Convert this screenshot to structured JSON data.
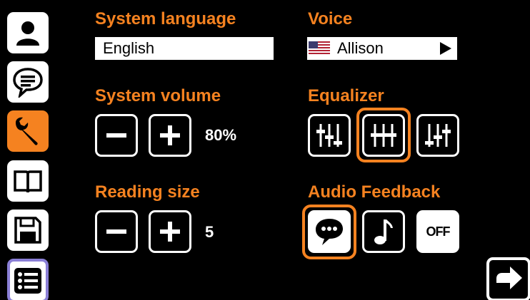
{
  "colors": {
    "accent": "#f58220",
    "background": "#000000",
    "foreground": "#ffffff",
    "menu_border": "#8a7fd6"
  },
  "sidebar": {
    "items": [
      {
        "icon": "user-icon"
      },
      {
        "icon": "speech-bubble-icon"
      },
      {
        "icon": "wrench-icon",
        "active": true
      },
      {
        "icon": "book-icon"
      },
      {
        "icon": "floppy-disk-icon"
      },
      {
        "icon": "list-icon"
      }
    ]
  },
  "settings": {
    "system_language": {
      "label": "System language",
      "value": "English"
    },
    "voice": {
      "label": "Voice",
      "value": "Allison",
      "flag_icon": "us-flag-icon"
    },
    "system_volume": {
      "label": "System volume",
      "value": "80%"
    },
    "equalizer": {
      "label": "Equalizer",
      "options": [
        "eq-preset-1-icon",
        "eq-preset-2-icon",
        "eq-preset-3-icon"
      ],
      "selected_index": 1
    },
    "reading_size": {
      "label": "Reading size",
      "value": "5"
    },
    "audio_feedback": {
      "label": "Audio Feedback",
      "options": [
        "speech-icon",
        "music-note-icon",
        "off-icon"
      ],
      "selected_index": 0,
      "off_label": "OFF"
    }
  },
  "next_button": {
    "icon": "arrow-right-icon"
  }
}
